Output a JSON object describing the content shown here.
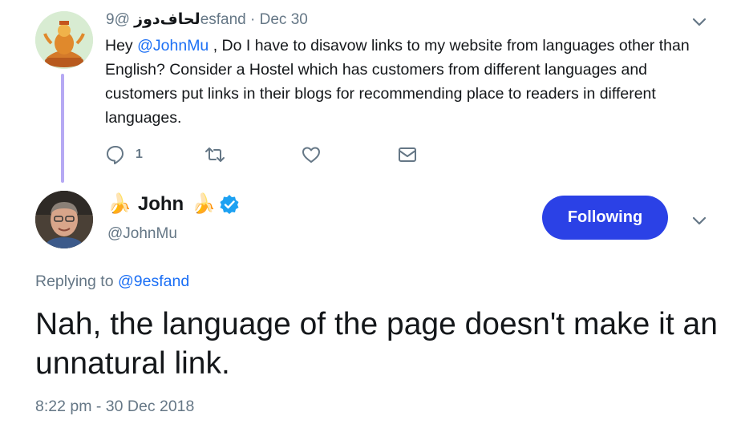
{
  "parent_tweet": {
    "display_name": "لحاف‌دوز",
    "handle": "@9esfand",
    "separator": "·",
    "date": "Dec 30",
    "text_prefix": "Hey ",
    "mention": "@JohnMu",
    "text_suffix": " , Do I have to disavow links to my website from languages other than English? Consider a Hostel which has customers from different languages and customers put links in their blogs for recommending place to readers in different languages.",
    "actions": {
      "reply_count": "1",
      "reply_icon": "reply-icon",
      "retweet_icon": "retweet-icon",
      "like_icon": "heart-icon",
      "dm_icon": "envelope-icon"
    }
  },
  "main_tweet": {
    "name_prefix_emoji": "🍌",
    "display_name": "John",
    "name_suffix_emoji": "🍌",
    "handle": "@JohnMu",
    "follow_label": "Following",
    "replying_to_label": "Replying to ",
    "replying_to_handle": "@9esfand",
    "text": "Nah, the language of the page doesn't make it an unnatural link.",
    "timestamp": "8:22 pm - 30 Dec 2018"
  },
  "colors": {
    "accent": "#1b6ff5",
    "follow_button": "#2b41e6",
    "secondary_text": "#657786",
    "thread_line": "#b6a9f4",
    "verified": "#1da1f2"
  }
}
